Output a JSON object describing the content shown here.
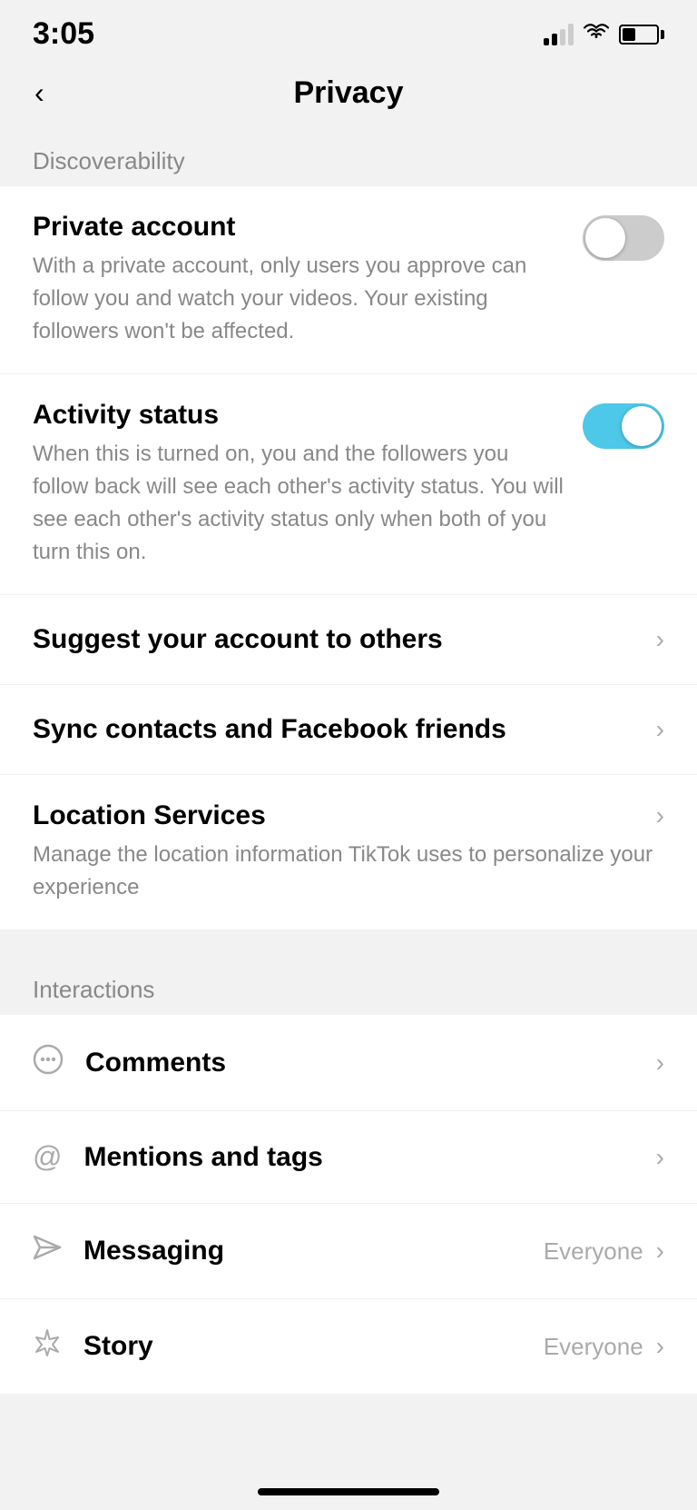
{
  "statusBar": {
    "time": "3:05"
  },
  "header": {
    "backLabel": "<",
    "title": "Privacy"
  },
  "discoverability": {
    "sectionLabel": "Discoverability",
    "privateAccount": {
      "title": "Private account",
      "description": "With a private account, only users you approve can follow you and watch your videos. Your existing followers won't be affected.",
      "enabled": false
    },
    "activityStatus": {
      "title": "Activity status",
      "description": "When this is turned on, you and the followers you follow back will see each other's activity status. You will see each other's activity status only when both of you turn this on.",
      "enabled": true
    },
    "suggestAccount": {
      "title": "Suggest your account to others"
    },
    "syncContacts": {
      "title": "Sync contacts and Facebook friends"
    },
    "locationServices": {
      "title": "Location Services",
      "description": "Manage the location information TikTok uses to personalize your experience"
    }
  },
  "interactions": {
    "sectionLabel": "Interactions",
    "comments": {
      "title": "Comments"
    },
    "mentionsAndTags": {
      "title": "Mentions and tags"
    },
    "messaging": {
      "title": "Messaging",
      "value": "Everyone"
    },
    "story": {
      "title": "Story",
      "value": "Everyone"
    }
  },
  "icons": {
    "chevronRight": "›",
    "commentIcon": "💬",
    "mentionIcon": "@",
    "messagingIcon": "✈",
    "storyIcon": "✦"
  }
}
